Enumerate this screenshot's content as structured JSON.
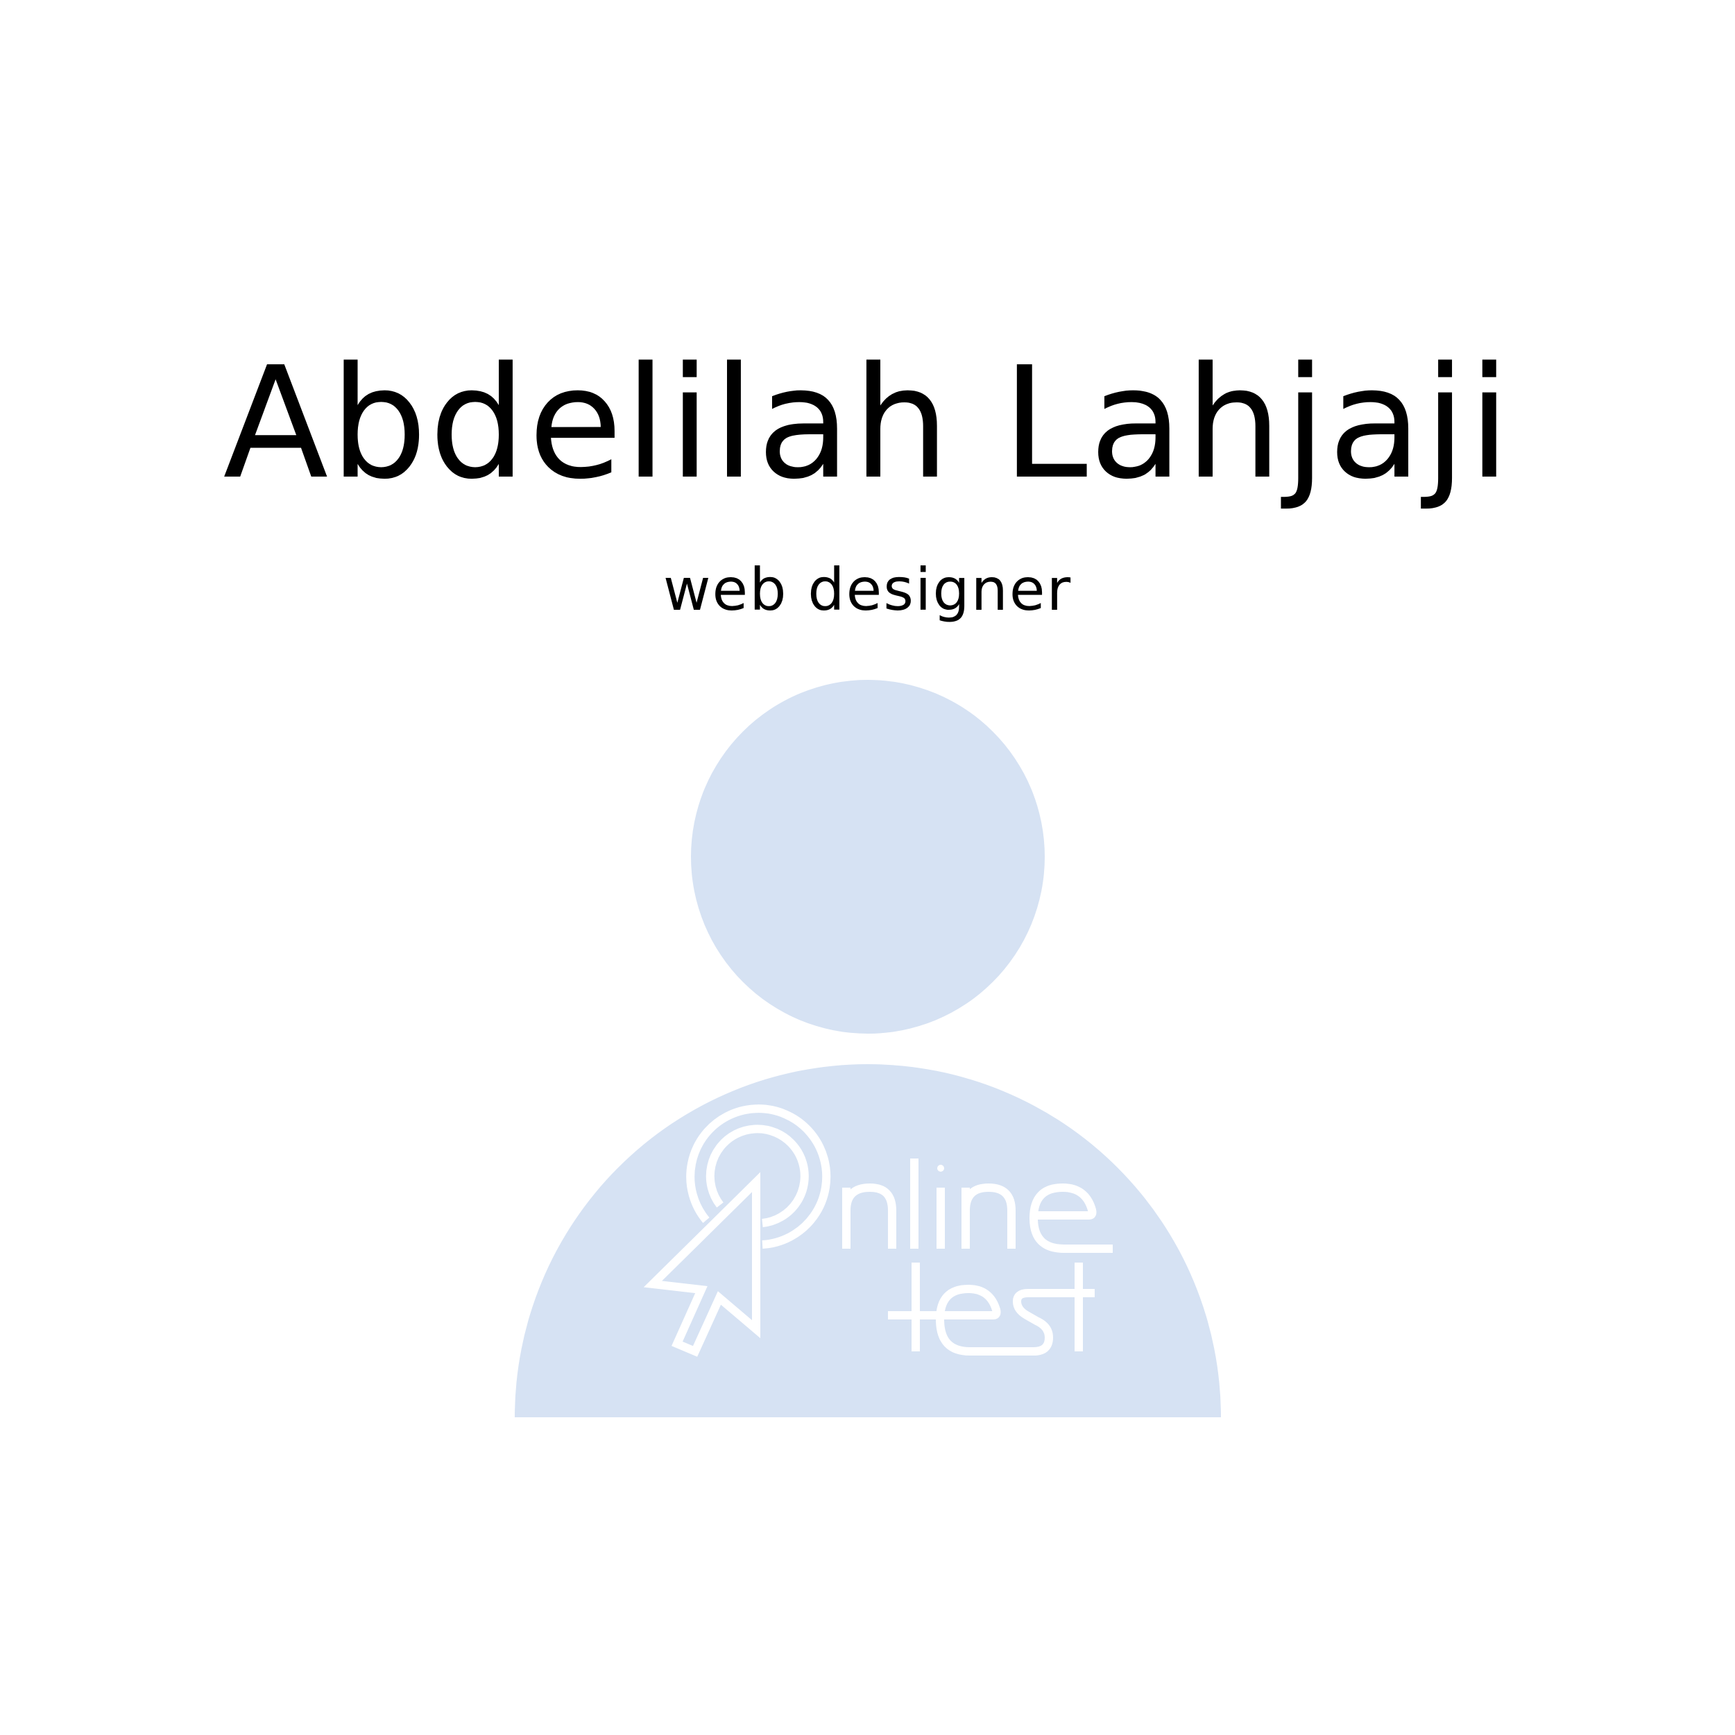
{
  "profile": {
    "name": "Abdelilah Lahjaji",
    "role": "web designer"
  },
  "avatar": {
    "color": "#d6e2f3",
    "icon": "user-silhouette-icon"
  },
  "logo": {
    "text_line1": "online",
    "text_line2": "test",
    "icon": "cursor-click-icon",
    "color": "#ffffff"
  }
}
